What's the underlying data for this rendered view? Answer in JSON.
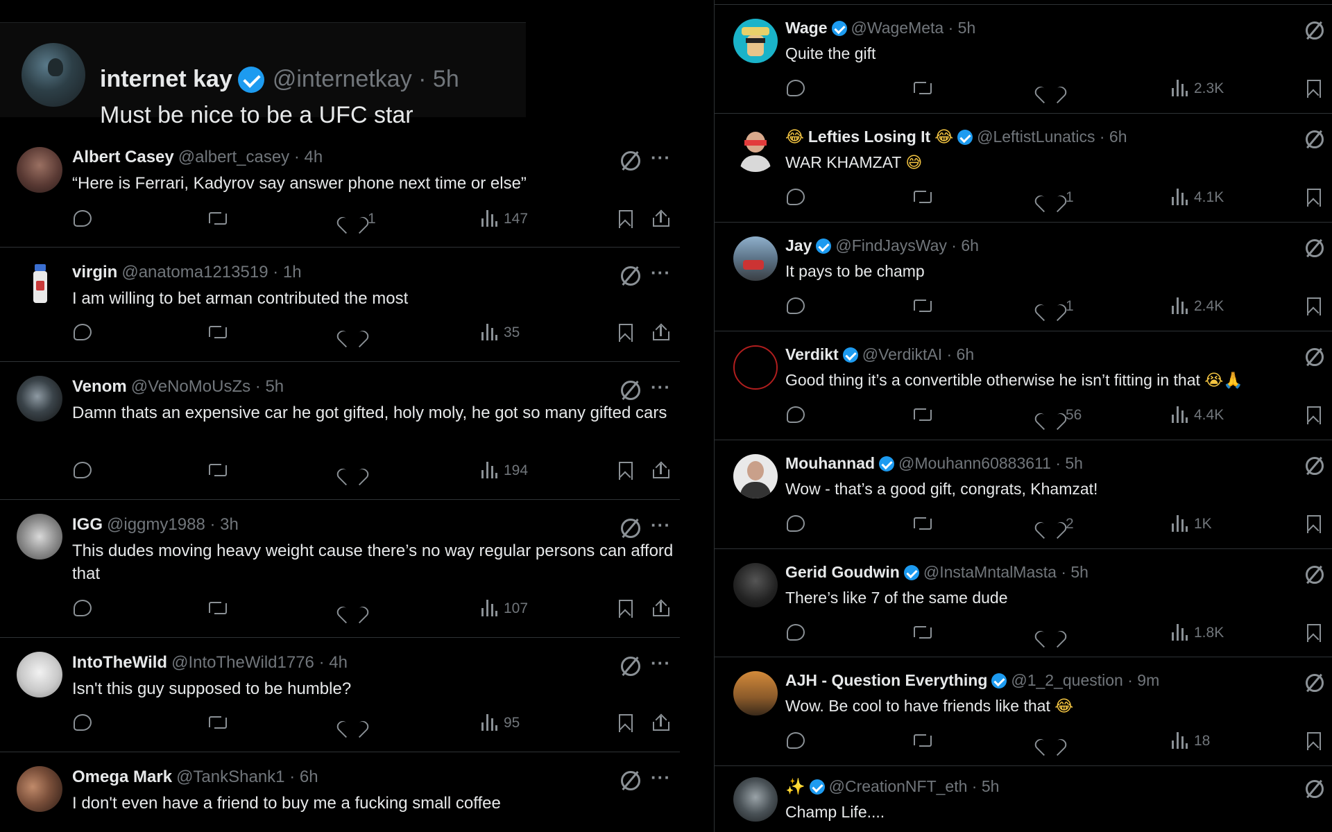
{
  "quote": {
    "name": "internet kay",
    "handle_time": "@internetkay · 5h",
    "text": "Must be nice to be a UFC star"
  },
  "left_replies": [
    {
      "name": "Albert Casey",
      "meta": "@albert_casey · 4h",
      "text": "“Here is Ferrari, Kadyrov say answer phone next time or else”",
      "likes": "1",
      "views": "147"
    },
    {
      "name": "virgin",
      "meta": "@anatoma1213519 · 1h",
      "text": "I am willing to bet arman contributed the most",
      "likes": "",
      "views": "35"
    },
    {
      "name": "Venom",
      "meta": "@VeNoMoUsZs · 5h",
      "text": "Damn thats an expensive car he got gifted, holy moly, he got so many gifted cars",
      "likes": "",
      "views": "194"
    },
    {
      "name": "IGG",
      "meta": "@iggmy1988 · 3h",
      "text": "This dudes moving heavy weight cause there’s no way regular persons can afford that",
      "likes": "",
      "views": "107"
    },
    {
      "name": "IntoTheWild",
      "meta": "@IntoTheWild1776 · 4h",
      "text": "Isn't this guy supposed to be humble?",
      "likes": "",
      "views": "95"
    },
    {
      "name": "Omega Mark",
      "meta": "@TankShank1 · 6h",
      "text": "I don't even have a friend to buy me a fucking small coffee",
      "likes": "",
      "views": ""
    }
  ],
  "right_replies": [
    {
      "name": "Wage",
      "meta": "@WageMeta · 5h",
      "text": "Quite the gift",
      "likes": "",
      "views": "2.3K"
    },
    {
      "name": "Lefties Losing It",
      "meta": "@LeftistLunatics · 6h",
      "text": "WAR KHAMZAT",
      "likes": "1",
      "views": "4.1K"
    },
    {
      "name": "Jay",
      "meta": "@FindJaysWay · 6h",
      "text": "It pays to be champ",
      "likes": "1",
      "views": "2.4K"
    },
    {
      "name": "Verdikt",
      "meta": "@VerdiktAI · 6h",
      "text": "Good thing it’s a convertible otherwise he isn’t fitting in that",
      "likes": "56",
      "views": "4.4K"
    },
    {
      "name": "Mouhannad",
      "meta": "@Mouhann60883611 · 5h",
      "text": "Wow - that’s a good gift, congrats, Khamzat!",
      "likes": "2",
      "views": "1K"
    },
    {
      "name": "Gerid Goudwin",
      "meta": "@InstaMntalMasta · 5h",
      "text": "There’s like 7 of the same dude",
      "likes": "",
      "views": "1.8K"
    },
    {
      "name": "AJH - Question Everything",
      "meta": "@1_2_question · 9m",
      "text": "Wow. Be cool to have friends like that",
      "likes": "",
      "views": "18"
    },
    {
      "name": "✨",
      "meta": "@CreationNFT_eth · 5h",
      "text": "Champ Life....",
      "likes": "",
      "views": ""
    }
  ],
  "emojis": {
    "laugh": "😂",
    "smile": "😅",
    "cry": "😭",
    "pray": "🙏",
    "ellipsis": "···"
  },
  "colors": {
    "background": "#000000",
    "text": "#e7e9ea",
    "muted": "#71767b",
    "verified": "#1d9bf0",
    "divider": "#2f3336"
  }
}
